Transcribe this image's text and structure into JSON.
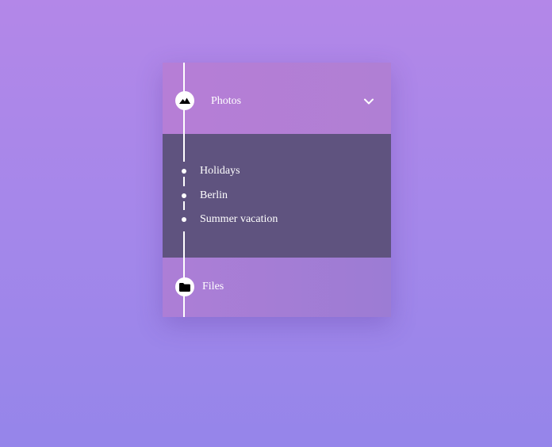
{
  "menu": {
    "header": {
      "label": "Photos",
      "icon": "mountains-icon",
      "toggle_icon": "chevron-down-icon"
    },
    "submenu": {
      "items": [
        {
          "label": "Holidays"
        },
        {
          "label": "Berlin"
        },
        {
          "label": "Summer vacation"
        }
      ]
    },
    "footer": {
      "label": "Files",
      "icon": "folder-icon"
    }
  },
  "colors": {
    "background_top": "#b387e8",
    "background_bottom": "#9585ea",
    "header": "#b67ed6",
    "submenu": "#5f537f",
    "footer": "#a47dd5",
    "accent": "#ffffff"
  }
}
